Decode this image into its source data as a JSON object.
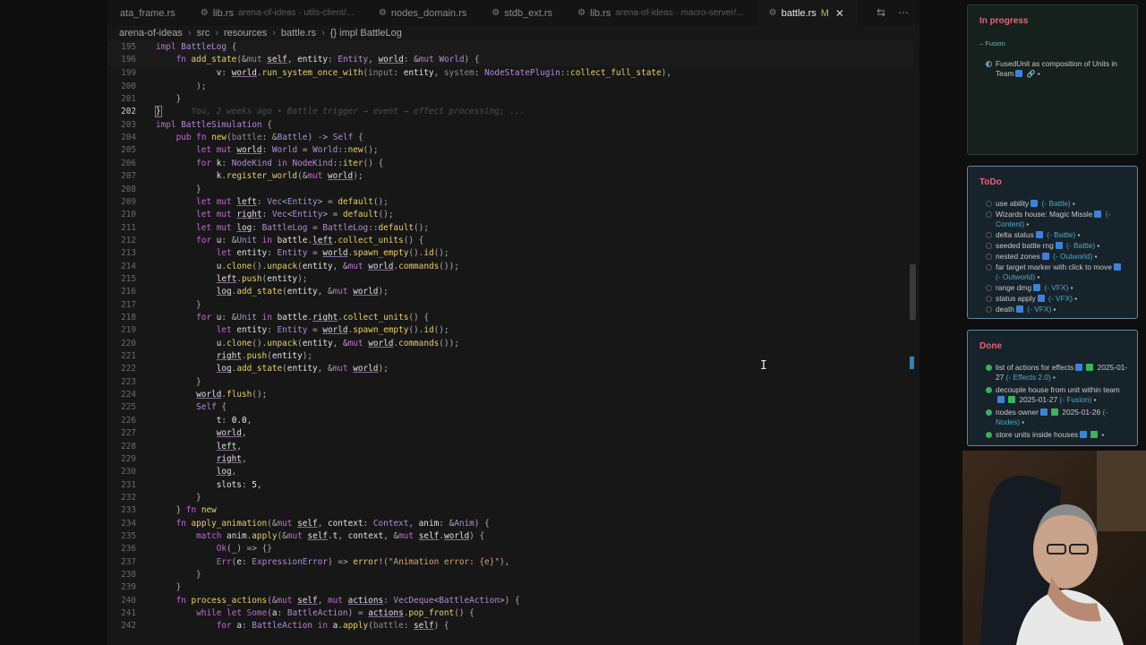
{
  "tabs": [
    {
      "label": "ata_frame.rs",
      "path": "",
      "active": false
    },
    {
      "label": "lib.rs",
      "path": "arena-of-ideas · utils-client/...",
      "active": false
    },
    {
      "label": "nodes_domain.rs",
      "path": "",
      "active": false
    },
    {
      "label": "stdb_ext.rs",
      "path": "",
      "active": false
    },
    {
      "label": "lib.rs",
      "path": "arena-of-ideas · macro-server/...",
      "active": false
    },
    {
      "label": "battle.rs",
      "path": "",
      "active": true,
      "modified": "M"
    }
  ],
  "breadcrumb": [
    "arena-of-ideas",
    "src",
    "resources",
    "battle.rs",
    "{} impl BattleLog"
  ],
  "blame": "You, 2 weeks ago • Battle trigger → event → effect processing; ...",
  "code": {
    "sticky": [
      {
        "n": "195",
        "text": "impl BattleLog {"
      },
      {
        "n": "196",
        "text": "    fn add_state(&mut self, entity: Entity, world: &mut World) {"
      }
    ],
    "lines": [
      {
        "n": "198",
        "text": "            k: entity,"
      },
      {
        "n": "199",
        "text": "            v: world.run_system_once_with(input: entity, system: NodeStatePlugin::collect_full_state),"
      },
      {
        "n": "200",
        "text": "        );"
      },
      {
        "n": "201",
        "text": "    }"
      },
      {
        "n": "202",
        "text": "}"
      },
      {
        "n": "203",
        "text": "impl BattleSimulation {"
      },
      {
        "n": "204",
        "text": "    pub fn new(battle: &Battle) -> Self {"
      },
      {
        "n": "205",
        "text": "        let mut world: World = World::new();"
      },
      {
        "n": "206",
        "text": "        for k: NodeKind in NodeKind::iter() {"
      },
      {
        "n": "207",
        "text": "            k.register_world(&mut world);"
      },
      {
        "n": "208",
        "text": "        }"
      },
      {
        "n": "209",
        "text": "        let mut left: Vec<Entity> = default();"
      },
      {
        "n": "210",
        "text": "        let mut right: Vec<Entity> = default();"
      },
      {
        "n": "211",
        "text": "        let mut log: BattleLog = BattleLog::default();"
      },
      {
        "n": "212",
        "text": "        for u: &Unit in battle.left.collect_units() {"
      },
      {
        "n": "213",
        "text": "            let entity: Entity = world.spawn_empty().id();"
      },
      {
        "n": "214",
        "text": "            u.clone().unpack(entity, &mut world.commands());"
      },
      {
        "n": "215",
        "text": "            left.push(entity);"
      },
      {
        "n": "216",
        "text": "            log.add_state(entity, &mut world);"
      },
      {
        "n": "217",
        "text": "        }"
      },
      {
        "n": "218",
        "text": "        for u: &Unit in battle.right.collect_units() {"
      },
      {
        "n": "219",
        "text": "            let entity: Entity = world.spawn_empty().id();"
      },
      {
        "n": "220",
        "text": "            u.clone().unpack(entity, &mut world.commands());"
      },
      {
        "n": "221",
        "text": "            right.push(entity);"
      },
      {
        "n": "222",
        "text": "            log.add_state(entity, &mut world);"
      },
      {
        "n": "223",
        "text": "        }"
      },
      {
        "n": "224",
        "text": "        world.flush();"
      },
      {
        "n": "225",
        "text": "        Self {"
      },
      {
        "n": "226",
        "text": "            t: 0.0,"
      },
      {
        "n": "227",
        "text": "            world,"
      },
      {
        "n": "228",
        "text": "            left,"
      },
      {
        "n": "229",
        "text": "            right,"
      },
      {
        "n": "230",
        "text": "            log,"
      },
      {
        "n": "231",
        "text": "            slots: 5,"
      },
      {
        "n": "232",
        "text": "        }"
      },
      {
        "n": "233",
        "text": "    } fn new"
      },
      {
        "n": "234",
        "text": "    fn apply_animation(&mut self, context: Context, anim: &Anim) {"
      },
      {
        "n": "235",
        "text": "        match anim.apply(&mut self.t, context, &mut self.world) {"
      },
      {
        "n": "236",
        "text": "            Ok(_) => {}"
      },
      {
        "n": "237",
        "text": "            Err(e: ExpressionError) => error!(\"Animation error: {e}\"),"
      },
      {
        "n": "238",
        "text": "        }"
      },
      {
        "n": "239",
        "text": "    }"
      },
      {
        "n": "240",
        "text": "    fn process_actions(&mut self, mut actions: VecDeque<BattleAction>) {"
      },
      {
        "n": "241",
        "text": "        while let Some(a: BattleAction) = actions.pop_front() {"
      },
      {
        "n": "242",
        "text": "            for a: BattleAction in a.apply(battle: self) {"
      }
    ]
  },
  "panel": {
    "in_progress": {
      "title": "In progress",
      "sub": "– Fusion",
      "items": [
        {
          "text": "FusedUnit as composition of Units in Team",
          "state": "half"
        }
      ]
    },
    "todo": {
      "title": "ToDo",
      "items": [
        {
          "text": "use ability",
          "tag": "(- Battle)"
        },
        {
          "text": "Wizards house: Magic Missle",
          "tag": "(- Content)"
        },
        {
          "text": "delta status",
          "tag": "(- Battle)"
        },
        {
          "text": "seeded battle rng",
          "tag": "(- Battle)"
        },
        {
          "text": "nested zones",
          "tag": "(- Outworld)"
        },
        {
          "text": "far target marker with click to move",
          "tag": "(- Outworld)"
        },
        {
          "text": "range dmg",
          "tag": "(- VFX)"
        },
        {
          "text": "status apply",
          "tag": "(- VFX)"
        },
        {
          "text": "death",
          "tag": "(- VFX)"
        }
      ]
    },
    "done": {
      "title": "Done",
      "items": [
        {
          "text": "list of actions for effects",
          "date": "2025-01-27",
          "tag": "(- Effects 2.0)"
        },
        {
          "text": "decouple house from unit within team",
          "date": "2025-01-27",
          "tag": "(- Fusion)"
        },
        {
          "text": "nodes owner",
          "date": "2025-01-26",
          "tag": "(- Nodes)"
        },
        {
          "text": "store units inside houses",
          "date": "",
          "tag": ""
        }
      ]
    }
  },
  "colors": {
    "accent_title": "#e9607a",
    "tag": "#4fa8c8",
    "badge_blue": "#3d82d9",
    "badge_green": "#3db35a"
  }
}
